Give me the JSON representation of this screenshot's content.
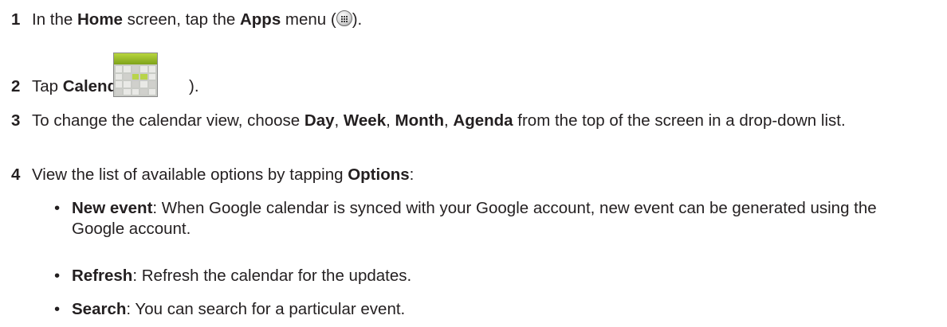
{
  "steps": [
    {
      "number": "1",
      "parts": {
        "a": "In the ",
        "b": "Home",
        "c": " screen, tap the ",
        "d": "Apps",
        "e": " menu (",
        "f": ")."
      }
    },
    {
      "number": "2",
      "parts": {
        "a": "Tap ",
        "b": "Calendar",
        "c": " (",
        "d": ")."
      }
    },
    {
      "number": "3",
      "parts": {
        "a": "To change the calendar view, choose ",
        "b": "Day",
        "c": ", ",
        "d": "Week",
        "e": ", ",
        "f": "Month",
        "g": ", ",
        "h": "Agenda",
        "i": " from the top of the screen in a drop-down list."
      }
    },
    {
      "number": "4",
      "parts": {
        "a": "View the list of available options by tapping ",
        "b": "Options",
        "c": ":"
      }
    }
  ],
  "options": [
    {
      "bullet": "•",
      "term": "New event",
      "desc": ": When Google calendar is synced with your Google account, new event can be generated using the Google account."
    },
    {
      "bullet": "•",
      "term": "Refresh",
      "desc": ": Refresh the calendar for the updates."
    },
    {
      "bullet": "•",
      "term": "Search",
      "desc": ": You can search for a particular event."
    }
  ],
  "icons": {
    "apps_menu": "apps-menu-icon",
    "calendar_app": "calendar-app-icon"
  },
  "colors": {
    "text": "#231f20",
    "calendar_header": "#9cbf2a"
  }
}
